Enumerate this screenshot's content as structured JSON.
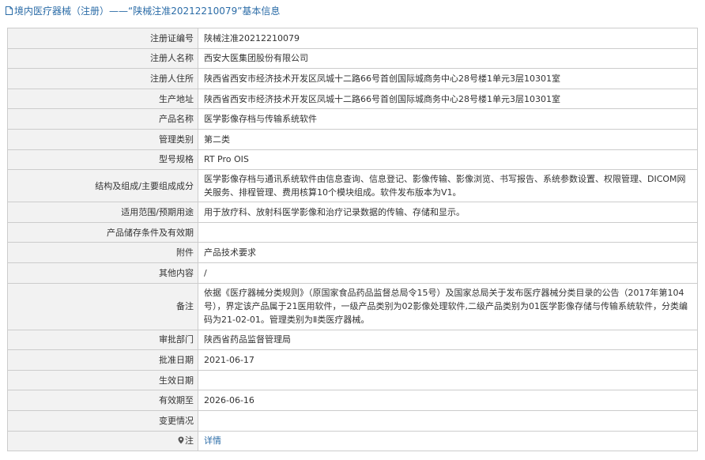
{
  "header": {
    "title": "境内医疗器械（注册）——“陕械注准20212210079”基本信息"
  },
  "rows": [
    {
      "label": "注册证编号",
      "value": "陕械注准20212210079"
    },
    {
      "label": "注册人名称",
      "value": "西安大医集团股份有限公司"
    },
    {
      "label": "注册人住所",
      "value": "陕西省西安市经济技术开发区凤城十二路66号首创国际城商务中心28号楼1单元3层10301室"
    },
    {
      "label": "生产地址",
      "value": "陕西省西安市经济技术开发区凤城十二路66号首创国际城商务中心28号楼1单元3层10301室"
    },
    {
      "label": "产品名称",
      "value": "医学影像存档与传输系统软件"
    },
    {
      "label": "管理类别",
      "value": "第二类"
    },
    {
      "label": "型号规格",
      "value": "RT Pro OIS"
    },
    {
      "label": "结构及组成/主要组成成分",
      "value": "医学影像存档与通讯系统软件由信息查询、信息登记、影像传输、影像浏览、书写报告、系统参数设置、权限管理、DICOM网关服务、排程管理、费用核算10个模块组成。软件发布版本为V1。"
    },
    {
      "label": "适用范围/预期用途",
      "value": "用于放疗科、放射科医学影像和治疗记录数据的传输、存储和显示。"
    },
    {
      "label": "产品储存条件及有效期",
      "value": ""
    },
    {
      "label": "附件",
      "value": "产品技术要求"
    },
    {
      "label": "其他内容",
      "value": "/"
    },
    {
      "label": "备注",
      "value": "依据《医疗器械分类规则》（原国家食品药品监督总局令15号）及国家总局关于发布医疗器械分类目录的公告（2017年第104号），界定该产品属于21医用软件，一级产品类别为02影像处理软件,二级产品类别为01医学影像存储与传输系统软件，分类编码为21-02-01。管理类别为Ⅱ类医疗器械。"
    },
    {
      "label": "审批部门",
      "value": "陕西省药品监督管理局"
    },
    {
      "label": "批准日期",
      "value": "2021-06-17"
    },
    {
      "label": "生效日期",
      "value": ""
    },
    {
      "label": "有效期至",
      "value": "2026-06-16"
    },
    {
      "label": "变更情况",
      "value": ""
    }
  ],
  "note": {
    "label": "注",
    "link_text": "详情",
    "icon": "pin-icon"
  },
  "colors": {
    "title": "#2b6ca7",
    "label_bg": "#f2f2f2",
    "border": "#cccccc",
    "link": "#2b6ca7"
  }
}
